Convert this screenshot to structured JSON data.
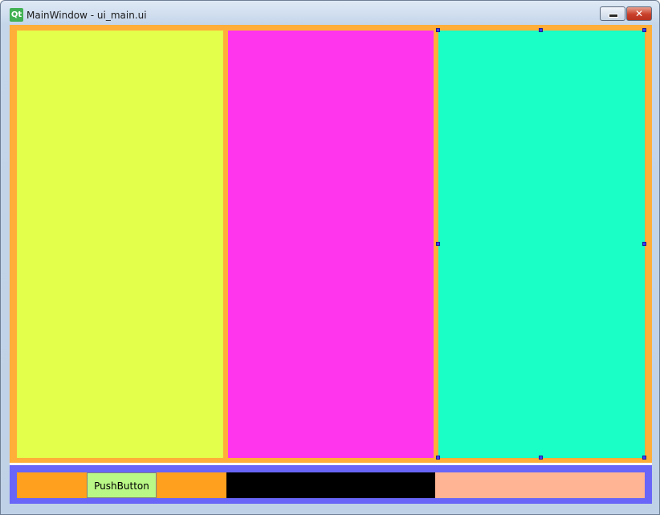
{
  "window": {
    "title": "MainWindow - ui_main.ui",
    "app_icon_text": "Qt",
    "minimize_glyph": "",
    "close_glyph": "✕"
  },
  "layout": {
    "top_background": "#ffae3a",
    "panels": [
      {
        "name": "left",
        "color": "#e4ff4b"
      },
      {
        "name": "middle",
        "color": "#ff34ed"
      },
      {
        "name": "right",
        "color": "#19ffc6",
        "selected": true
      }
    ],
    "bottom_background": "#6865f8",
    "bottom_segments": {
      "left_orange": "#ffa01e",
      "right_orange": "#ffa01e",
      "black": "#000000",
      "salmon": "#ffb593"
    }
  },
  "push_button": {
    "label": "PushButton",
    "color": "#b9f886"
  }
}
